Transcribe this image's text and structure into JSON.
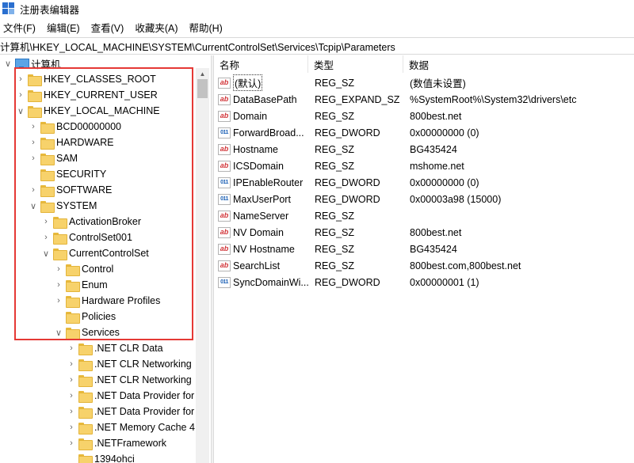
{
  "window": {
    "title": "注册表编辑器"
  },
  "menu": [
    "文件(F)",
    "编辑(E)",
    "查看(V)",
    "收藏夹(A)",
    "帮助(H)"
  ],
  "address": "计算机\\HKEY_LOCAL_MACHINE\\SYSTEM\\CurrentControlSet\\Services\\Tcpip\\Parameters",
  "tree": {
    "computer": "计算机",
    "items": [
      {
        "label": "HKEY_CLASSES_ROOT",
        "depth": 1,
        "expander": "right"
      },
      {
        "label": "HKEY_CURRENT_USER",
        "depth": 1,
        "expander": "right"
      },
      {
        "label": "HKEY_LOCAL_MACHINE",
        "depth": 1,
        "expander": "down"
      },
      {
        "label": "BCD00000000",
        "depth": 2,
        "expander": "right"
      },
      {
        "label": "HARDWARE",
        "depth": 2,
        "expander": "right"
      },
      {
        "label": "SAM",
        "depth": 2,
        "expander": "right"
      },
      {
        "label": "SECURITY",
        "depth": 2,
        "expander": "none"
      },
      {
        "label": "SOFTWARE",
        "depth": 2,
        "expander": "right"
      },
      {
        "label": "SYSTEM",
        "depth": 2,
        "expander": "down"
      },
      {
        "label": "ActivationBroker",
        "depth": 3,
        "expander": "right"
      },
      {
        "label": "ControlSet001",
        "depth": 3,
        "expander": "right"
      },
      {
        "label": "CurrentControlSet",
        "depth": 3,
        "expander": "down"
      },
      {
        "label": "Control",
        "depth": 4,
        "expander": "right"
      },
      {
        "label": "Enum",
        "depth": 4,
        "expander": "right"
      },
      {
        "label": "Hardware Profiles",
        "depth": 4,
        "expander": "right"
      },
      {
        "label": "Policies",
        "depth": 4,
        "expander": "none"
      },
      {
        "label": "Services",
        "depth": 4,
        "expander": "down"
      },
      {
        "label": ".NET CLR Data",
        "depth": 5,
        "expander": "right"
      },
      {
        "label": ".NET CLR Networking",
        "depth": 5,
        "expander": "right"
      },
      {
        "label": ".NET CLR Networking",
        "depth": 5,
        "expander": "right"
      },
      {
        "label": ".NET Data Provider for",
        "depth": 5,
        "expander": "right"
      },
      {
        "label": ".NET Data Provider for",
        "depth": 5,
        "expander": "right"
      },
      {
        "label": ".NET Memory Cache 4",
        "depth": 5,
        "expander": "right"
      },
      {
        "label": ".NETFramework",
        "depth": 5,
        "expander": "right"
      },
      {
        "label": "1394ohci",
        "depth": 5,
        "expander": "none"
      }
    ]
  },
  "list": {
    "headers": {
      "name": "名称",
      "type": "类型",
      "data": "数据"
    },
    "rows": [
      {
        "icon": "ab",
        "name": "(默认)",
        "type": "REG_SZ",
        "data": "(数值未设置)"
      },
      {
        "icon": "ab",
        "name": "DataBasePath",
        "type": "REG_EXPAND_SZ",
        "data": "%SystemRoot%\\System32\\drivers\\etc"
      },
      {
        "icon": "ab",
        "name": "Domain",
        "type": "REG_SZ",
        "data": "800best.net"
      },
      {
        "icon": "bin",
        "name": "ForwardBroad...",
        "type": "REG_DWORD",
        "data": "0x00000000 (0)"
      },
      {
        "icon": "ab",
        "name": "Hostname",
        "type": "REG_SZ",
        "data": "BG435424"
      },
      {
        "icon": "ab",
        "name": "ICSDomain",
        "type": "REG_SZ",
        "data": "mshome.net"
      },
      {
        "icon": "bin",
        "name": "IPEnableRouter",
        "type": "REG_DWORD",
        "data": "0x00000000 (0)"
      },
      {
        "icon": "bin",
        "name": "MaxUserPort",
        "type": "REG_DWORD",
        "data": "0x00003a98 (15000)"
      },
      {
        "icon": "ab",
        "name": "NameServer",
        "type": "REG_SZ",
        "data": ""
      },
      {
        "icon": "ab",
        "name": "NV Domain",
        "type": "REG_SZ",
        "data": "800best.net"
      },
      {
        "icon": "ab",
        "name": "NV Hostname",
        "type": "REG_SZ",
        "data": "BG435424"
      },
      {
        "icon": "ab",
        "name": "SearchList",
        "type": "REG_SZ",
        "data": "800best.com,800best.net"
      },
      {
        "icon": "bin",
        "name": "SyncDomainWi...",
        "type": "REG_DWORD",
        "data": "0x00000001 (1)"
      }
    ]
  },
  "icon_glyphs": {
    "ab": "ab",
    "bin": "011"
  },
  "colors": {
    "highlight_border": "#e53935",
    "folder": "#f7d26b"
  }
}
